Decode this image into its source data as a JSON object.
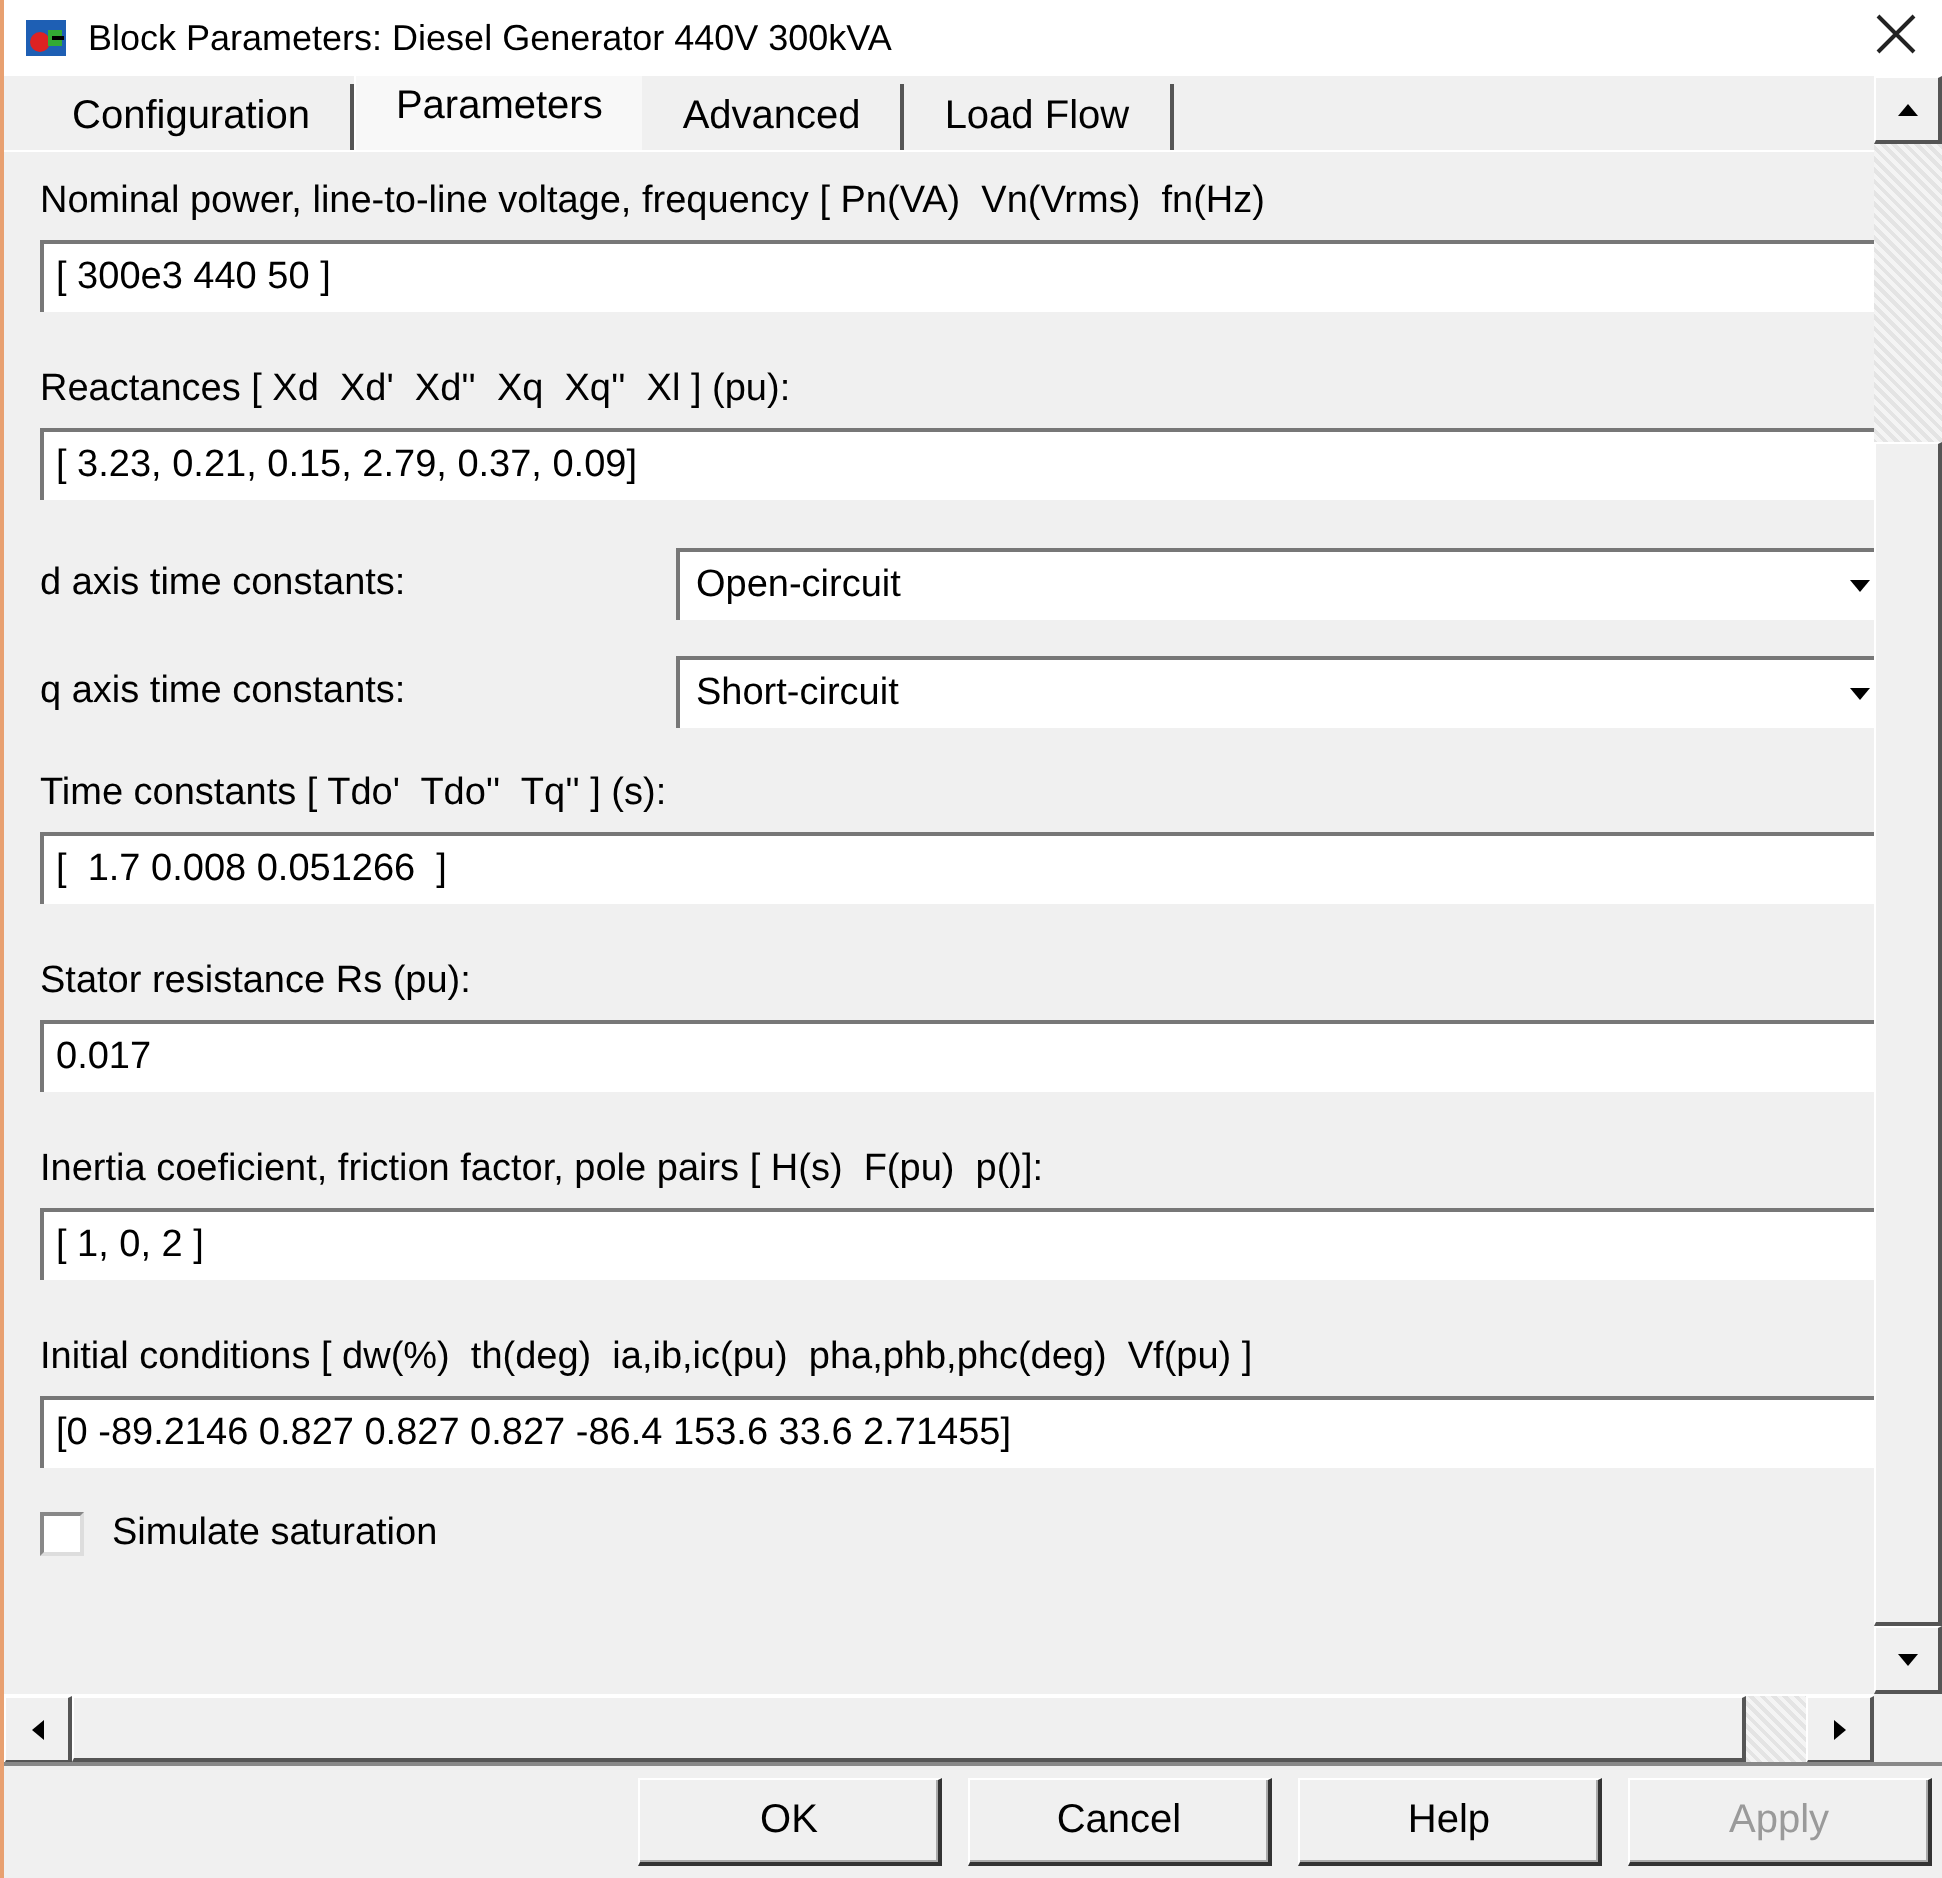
{
  "window": {
    "title": "Block Parameters: Diesel Generator 440V 300kVA"
  },
  "tabs": [
    {
      "label": "Configuration",
      "selected": false
    },
    {
      "label": "Parameters",
      "selected": true
    },
    {
      "label": "Advanced",
      "selected": false
    },
    {
      "label": "Load Flow",
      "selected": false
    }
  ],
  "parameters": [
    {
      "kind": "text",
      "label": "Nominal power, line-to-line voltage, frequency [ Pn(VA)  Vn(Vrms)  fn(Hz)",
      "value": "[ 300e3 440 50 ]"
    },
    {
      "kind": "text",
      "label": "Reactances [ Xd  Xd'  Xd''  Xq  Xq''  Xl ] (pu):",
      "value": "[ 3.23, 0.21, 0.15, 2.79, 0.37, 0.09]"
    },
    {
      "kind": "dropdown",
      "label": "d axis time constants:",
      "value": "Open-circuit"
    },
    {
      "kind": "dropdown",
      "label": "q axis time constants:",
      "value": "Short-circuit"
    },
    {
      "kind": "text",
      "label": "Time constants [ Tdo'  Tdo''  Tq'' ] (s):",
      "value": "[  1.7 0.008 0.051266  ]"
    },
    {
      "kind": "text",
      "label": "Stator resistance Rs (pu):",
      "value": "0.017"
    },
    {
      "kind": "text",
      "label": "Inertia coeficient, friction factor, pole pairs [ H(s)  F(pu)  p()]:",
      "value": "[ 1, 0, 2 ]"
    },
    {
      "kind": "text",
      "label": "Initial conditions [ dw(%)  th(deg)  ia,ib,ic(pu)  pha,phb,phc(deg)  Vf(pu) ]",
      "value": "[0 -89.2146 0.827 0.827 0.827 -86.4 153.6 33.6 2.71455]"
    }
  ],
  "simulate_saturation": {
    "label": "Simulate saturation",
    "checked": false
  },
  "buttons": [
    {
      "label": "OK",
      "disabled": false
    },
    {
      "label": "Cancel",
      "disabled": false
    },
    {
      "label": "Help",
      "disabled": false
    },
    {
      "label": "Apply",
      "disabled": true
    }
  ]
}
